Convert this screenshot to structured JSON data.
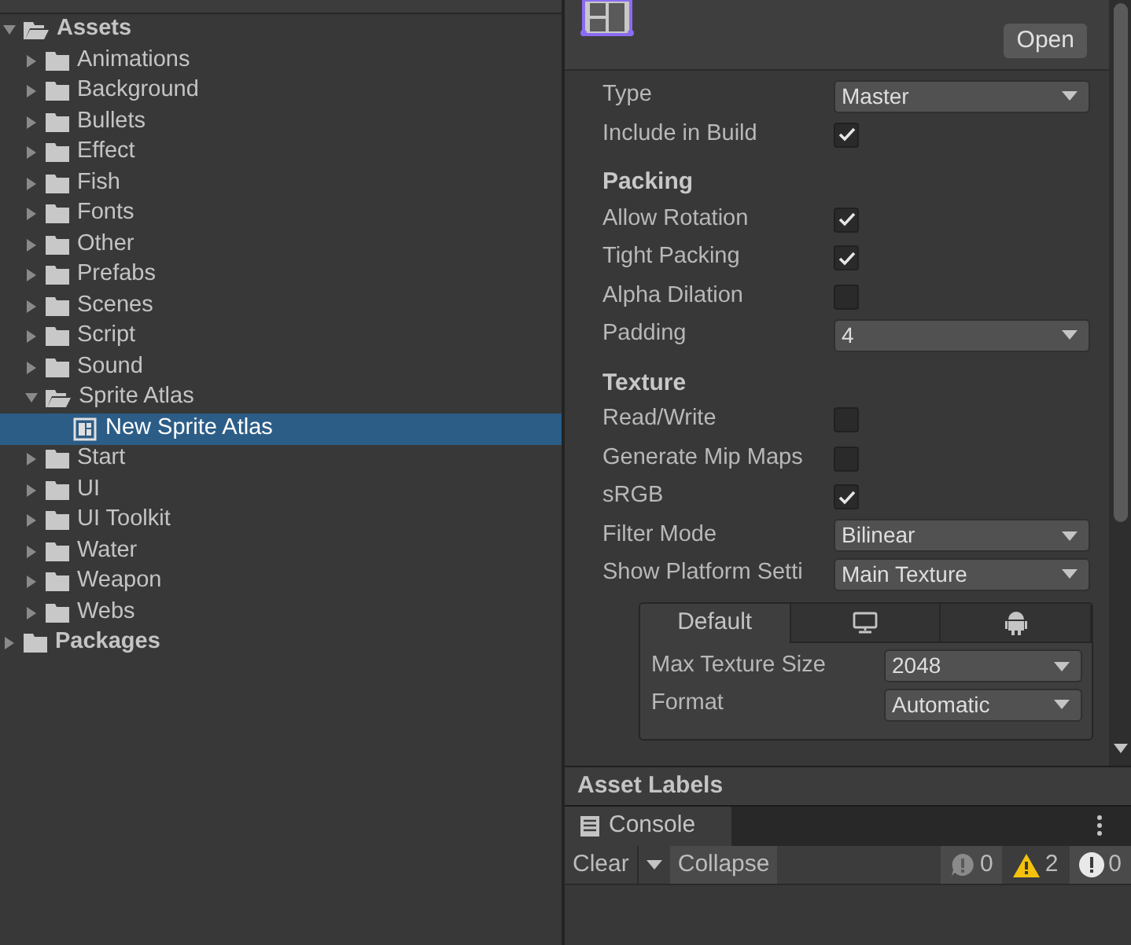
{
  "project_tree": [
    {
      "label": "Assets",
      "expanded": true,
      "selected": false,
      "kind": "folder",
      "children": [
        {
          "label": "Animations",
          "expanded": false,
          "selected": false,
          "kind": "folder"
        },
        {
          "label": "Background",
          "expanded": false,
          "selected": false,
          "kind": "folder"
        },
        {
          "label": "Bullets",
          "expanded": false,
          "selected": false,
          "kind": "folder"
        },
        {
          "label": "Effect",
          "expanded": false,
          "selected": false,
          "kind": "folder"
        },
        {
          "label": "Fish",
          "expanded": false,
          "selected": false,
          "kind": "folder"
        },
        {
          "label": "Fonts",
          "expanded": false,
          "selected": false,
          "kind": "folder"
        },
        {
          "label": "Other",
          "expanded": false,
          "selected": false,
          "kind": "folder"
        },
        {
          "label": "Prefabs",
          "expanded": false,
          "selected": false,
          "kind": "folder"
        },
        {
          "label": "Scenes",
          "expanded": false,
          "selected": false,
          "kind": "folder"
        },
        {
          "label": "Script",
          "expanded": false,
          "selected": false,
          "kind": "folder"
        },
        {
          "label": "Sound",
          "expanded": false,
          "selected": false,
          "kind": "folder"
        },
        {
          "label": "Sprite Atlas",
          "expanded": true,
          "selected": false,
          "kind": "folder",
          "children": [
            {
              "label": "New Sprite Atlas",
              "selected": true,
              "kind": "atlas"
            }
          ]
        },
        {
          "label": "Start",
          "expanded": false,
          "selected": false,
          "kind": "folder"
        },
        {
          "label": "UI",
          "expanded": false,
          "selected": false,
          "kind": "folder"
        },
        {
          "label": "UI Toolkit",
          "expanded": false,
          "selected": false,
          "kind": "folder"
        },
        {
          "label": "Water",
          "expanded": false,
          "selected": false,
          "kind": "folder"
        },
        {
          "label": "Weapon",
          "expanded": false,
          "selected": false,
          "kind": "folder"
        },
        {
          "label": "Webs",
          "expanded": false,
          "selected": false,
          "kind": "folder"
        }
      ]
    },
    {
      "label": "Packages",
      "expanded": false,
      "selected": false,
      "kind": "folder"
    }
  ],
  "inspector": {
    "open_button": "Open",
    "fields": [
      {
        "kind": "dropdown",
        "label": "Type",
        "value": "Master"
      },
      {
        "kind": "checkbox",
        "label": "Include in Build",
        "checked": true
      },
      {
        "kind": "header",
        "label": "Packing"
      },
      {
        "kind": "checkbox",
        "label": "Allow Rotation",
        "checked": true
      },
      {
        "kind": "checkbox",
        "label": "Tight Packing",
        "checked": true
      },
      {
        "kind": "checkbox",
        "label": "Alpha Dilation",
        "checked": false
      },
      {
        "kind": "dropdown",
        "label": "Padding",
        "value": "4"
      },
      {
        "kind": "header",
        "label": "Texture"
      },
      {
        "kind": "checkbox",
        "label": "Read/Write",
        "checked": false
      },
      {
        "kind": "checkbox",
        "label": "Generate Mip Maps",
        "checked": false
      },
      {
        "kind": "checkbox",
        "label": "sRGB",
        "checked": true
      },
      {
        "kind": "dropdown",
        "label": "Filter Mode",
        "value": "Bilinear"
      },
      {
        "kind": "dropdown",
        "label": "Show Platform Setti",
        "value": "Main Texture"
      }
    ],
    "platform_tabs": [
      {
        "kind": "text",
        "label": "Default",
        "selected": true
      },
      {
        "kind": "monitor",
        "selected": false
      },
      {
        "kind": "android",
        "selected": false
      }
    ],
    "platform_fields": [
      {
        "kind": "dropdown",
        "label": "Max Texture Size",
        "value": "2048"
      },
      {
        "kind": "dropdown",
        "label": "Format",
        "value": "Automatic"
      }
    ]
  },
  "asset_labels": "Asset Labels",
  "console": {
    "tab": "Console",
    "clear": "Clear",
    "collapse": "Collapse",
    "counts": [
      {
        "kind": "info",
        "count": "0"
      },
      {
        "kind": "warning",
        "count": "2"
      },
      {
        "kind": "error",
        "count": "0"
      }
    ]
  }
}
